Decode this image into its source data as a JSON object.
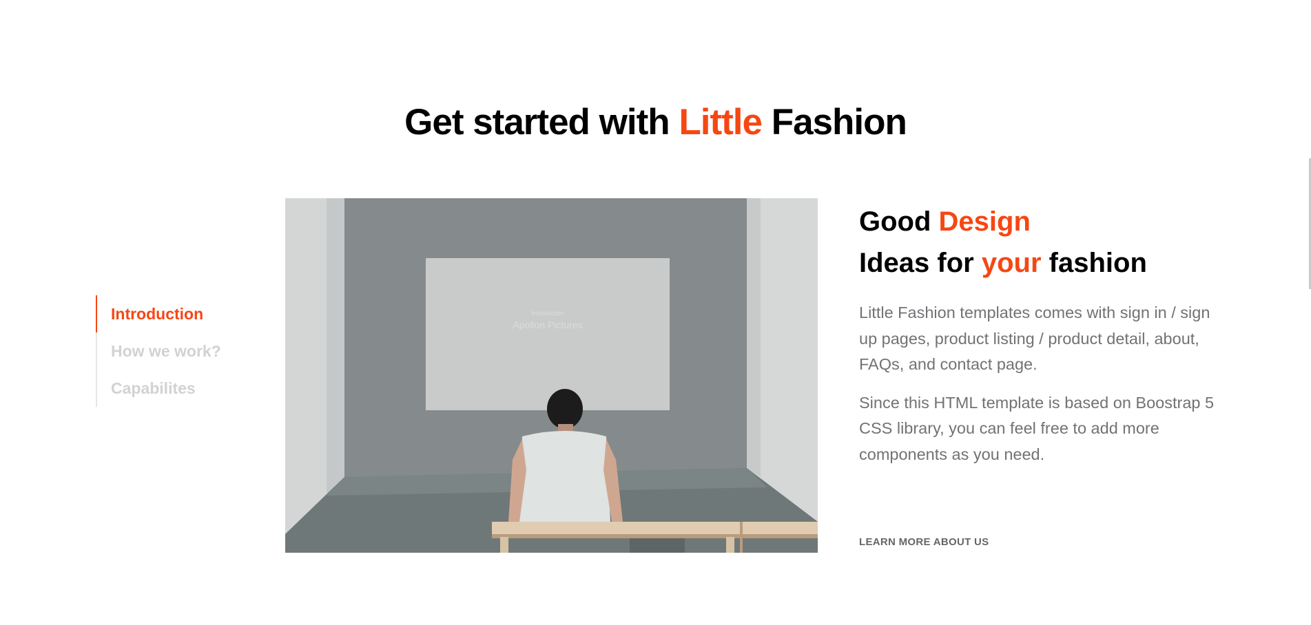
{
  "section": {
    "title_before": "Get started with ",
    "title_accent": "Little",
    "title_after": " Fashion"
  },
  "tabs": [
    {
      "label": "Introduction",
      "active": true
    },
    {
      "label": "How we work?",
      "active": false
    },
    {
      "label": "Capabilites",
      "active": false
    }
  ],
  "media": {
    "screen_line1": "Introduction",
    "screen_line2": "Apollon Pictures"
  },
  "content": {
    "heading_line1_before": "Good ",
    "heading_line1_accent": "Design",
    "heading_line2_before": "Ideas for ",
    "heading_line2_accent": "your",
    "heading_line2_after": " fashion",
    "paragraph1": "Little Fashion templates comes with sign in / sign up pages, product listing / product detail, about, FAQs, and contact page.",
    "paragraph2": "Since this HTML template is based on Boostrap 5 CSS library, you can feel free to add more components as you need.",
    "cta_label": "LEARN MORE ABOUT US"
  },
  "colors": {
    "accent": "#f64713",
    "heading": "#000000",
    "body_text": "#717275",
    "tab_inactive": "#d2d2d2"
  }
}
